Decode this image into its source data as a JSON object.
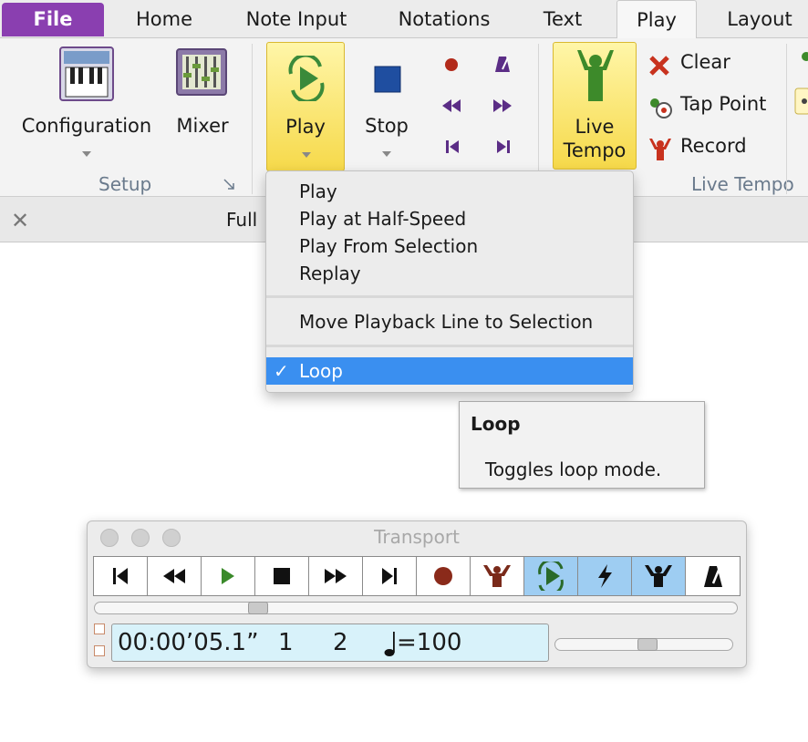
{
  "tabs": [
    {
      "label": "File"
    },
    {
      "label": "Home"
    },
    {
      "label": "Note Input"
    },
    {
      "label": "Notations"
    },
    {
      "label": "Text"
    },
    {
      "label": "Play"
    },
    {
      "label": "Layout"
    }
  ],
  "ribbon": {
    "setup": {
      "configuration_label": "Configuration",
      "mixer_label": "Mixer",
      "group_label": "Setup"
    },
    "transport": {
      "play_label": "Play",
      "stop_label": "Stop"
    },
    "live_tempo": {
      "live_tempo_line1": "Live",
      "live_tempo_line2": "Tempo",
      "clear_label": "Clear",
      "tap_point_label": "Tap Point",
      "record_label": "Record",
      "group_label": "Live Tempo"
    }
  },
  "document": {
    "tab_title": "Full"
  },
  "play_menu": {
    "items": [
      {
        "label": "Play"
      },
      {
        "label": "Play at Half-Speed"
      },
      {
        "label": "Play From Selection"
      },
      {
        "label": "Replay"
      },
      {
        "label": "Move Playback Line to Selection"
      },
      {
        "label": "Loop",
        "checked": true,
        "highlighted": true
      }
    ],
    "check_mark": "✓"
  },
  "tooltip": {
    "title": "Loop",
    "description": "Toggles loop mode."
  },
  "transport_window": {
    "title": "Transport",
    "buttons": [
      {
        "icon": "go-to-start-icon",
        "active": false
      },
      {
        "icon": "rewind-icon",
        "active": false
      },
      {
        "icon": "play-icon",
        "active": false
      },
      {
        "icon": "stop-icon",
        "active": false
      },
      {
        "icon": "fast-forward-icon",
        "active": false
      },
      {
        "icon": "go-to-end-icon",
        "active": false
      },
      {
        "icon": "record-icon",
        "active": false
      },
      {
        "icon": "live-tempo-conductor-icon",
        "active": false
      },
      {
        "icon": "loop-play-icon",
        "active": true
      },
      {
        "icon": "lightning-icon",
        "active": true
      },
      {
        "icon": "conductor-icon",
        "active": true
      },
      {
        "icon": "metronome-icon",
        "active": false
      }
    ],
    "counter": {
      "time": "00:00’05.1”",
      "bar": "1",
      "beat": "2",
      "tempo_equals": "=100"
    }
  },
  "colors": {
    "file_tab": "#8a3fb0",
    "highlight": "#3a8ff0",
    "active_transport_button": "#9ecdf2",
    "counter_bg": "#d8f2fa"
  }
}
